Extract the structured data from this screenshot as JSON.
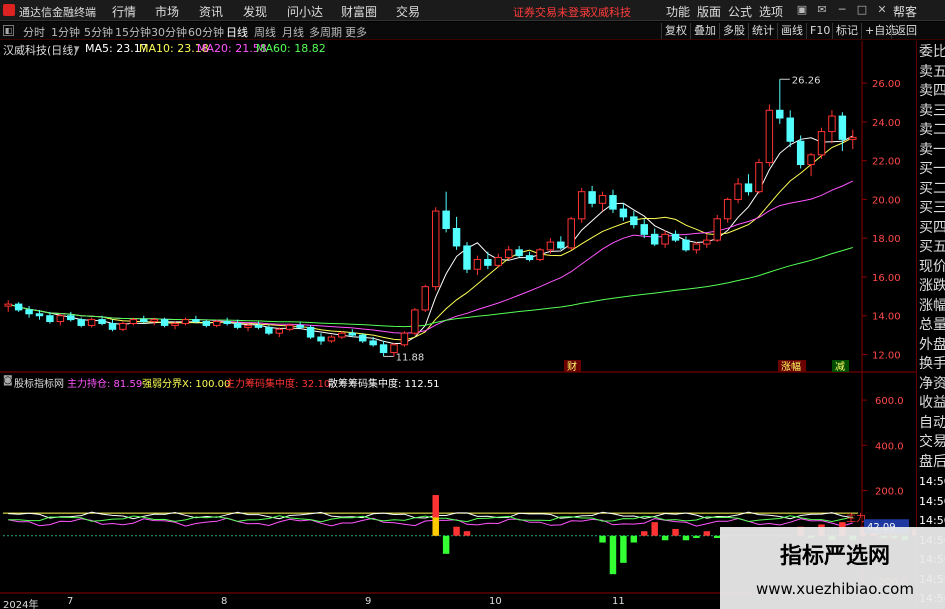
{
  "app": {
    "title": "通达信金融终端",
    "menu": [
      "行情",
      "市场",
      "资讯",
      "发现",
      "问小达",
      "财富圈",
      "交易"
    ],
    "login_status": "证券交易未登录",
    "stock_name": "汉威科技",
    "right_menu": [
      "功能",
      "版面",
      "公式",
      "选项"
    ],
    "helper": "帮客"
  },
  "toolbar": {
    "periods": [
      "分时",
      "1分钟",
      "5分钟",
      "15分钟",
      "30分钟",
      "60分钟",
      "日线",
      "周线",
      "月线",
      "多周期",
      "更多"
    ],
    "active_period": "日线",
    "right_buttons": [
      "复权",
      "叠加",
      "多股",
      "统计",
      "画线",
      "F10",
      "标记",
      "+自选",
      "返回"
    ]
  },
  "chart_header": {
    "symbol": "汉威科技(日线)",
    "ma": [
      {
        "label": "MA5: 23.17",
        "color": "#ffffff"
      },
      {
        "label": "MA10: 23.18",
        "color": "#ffff55"
      },
      {
        "label": "MA20: 21.58",
        "color": "#ff55ff"
      },
      {
        "label": "MA60: 18.82",
        "color": "#55ff55"
      }
    ]
  },
  "price_chart": {
    "type": "candlestick",
    "y_ticks": [
      "26.00",
      "24.00",
      "22.00",
      "20.00",
      "18.00",
      "16.00",
      "14.00",
      "12.00"
    ],
    "ylim": [
      11.2,
      27.4
    ],
    "high_label": "26.26",
    "low_label": "11.88",
    "event_tags": [
      "财",
      "涨幅",
      "减"
    ],
    "colors": {
      "up": "#ff3333",
      "down": "#54ffff"
    },
    "candles": [
      [
        14.5,
        14.8,
        14.2,
        14.6
      ],
      [
        14.6,
        14.7,
        14.2,
        14.3
      ],
      [
        14.3,
        14.5,
        13.9,
        14.1
      ],
      [
        14.1,
        14.3,
        13.8,
        14.0
      ],
      [
        14.0,
        14.2,
        13.6,
        13.7
      ],
      [
        13.7,
        14.1,
        13.5,
        14.0
      ],
      [
        14.0,
        14.2,
        13.7,
        13.8
      ],
      [
        13.8,
        13.9,
        13.4,
        13.5
      ],
      [
        13.5,
        13.9,
        13.4,
        13.8
      ],
      [
        13.8,
        14.0,
        13.5,
        13.6
      ],
      [
        13.6,
        13.8,
        13.2,
        13.3
      ],
      [
        13.3,
        13.7,
        13.2,
        13.6
      ],
      [
        13.6,
        13.9,
        13.5,
        13.8
      ],
      [
        13.8,
        14.0,
        13.6,
        13.7
      ],
      [
        13.7,
        13.9,
        13.5,
        13.8
      ],
      [
        13.8,
        13.9,
        13.4,
        13.5
      ],
      [
        13.5,
        13.7,
        13.3,
        13.6
      ],
      [
        13.6,
        13.9,
        13.5,
        13.8
      ],
      [
        13.8,
        14.0,
        13.6,
        13.7
      ],
      [
        13.7,
        13.8,
        13.4,
        13.5
      ],
      [
        13.5,
        13.8,
        13.4,
        13.7
      ],
      [
        13.7,
        13.9,
        13.5,
        13.6
      ],
      [
        13.6,
        13.8,
        13.3,
        13.4
      ],
      [
        13.4,
        13.6,
        13.2,
        13.5
      ],
      [
        13.5,
        13.7,
        13.3,
        13.4
      ],
      [
        13.4,
        13.5,
        13.0,
        13.1
      ],
      [
        13.1,
        13.4,
        12.9,
        13.3
      ],
      [
        13.3,
        13.6,
        13.2,
        13.5
      ],
      [
        13.5,
        13.7,
        13.3,
        13.4
      ],
      [
        13.4,
        13.5,
        12.8,
        12.9
      ],
      [
        12.9,
        13.1,
        12.5,
        12.7
      ],
      [
        12.7,
        13.0,
        12.6,
        12.9
      ],
      [
        12.9,
        13.2,
        12.8,
        13.1
      ],
      [
        13.1,
        13.3,
        12.9,
        13.0
      ],
      [
        13.0,
        13.1,
        12.6,
        12.7
      ],
      [
        12.7,
        12.9,
        12.4,
        12.5
      ],
      [
        12.5,
        12.7,
        11.9,
        12.1
      ],
      [
        12.1,
        12.6,
        11.9,
        12.5
      ],
      [
        12.5,
        13.2,
        12.4,
        13.1
      ],
      [
        13.1,
        14.4,
        13.0,
        14.3
      ],
      [
        14.3,
        15.6,
        14.2,
        15.5
      ],
      [
        15.5,
        19.6,
        15.3,
        19.4
      ],
      [
        19.4,
        20.4,
        18.3,
        18.5
      ],
      [
        18.5,
        19.1,
        17.4,
        17.6
      ],
      [
        17.6,
        17.8,
        16.2,
        16.4
      ],
      [
        16.4,
        17.1,
        16.1,
        16.9
      ],
      [
        16.9,
        17.3,
        16.4,
        16.6
      ],
      [
        16.6,
        17.2,
        16.5,
        17.0
      ],
      [
        17.0,
        17.6,
        16.9,
        17.4
      ],
      [
        17.4,
        17.6,
        17.0,
        17.1
      ],
      [
        17.1,
        17.3,
        16.8,
        16.9
      ],
      [
        16.9,
        17.5,
        16.8,
        17.4
      ],
      [
        17.4,
        18.0,
        17.2,
        17.8
      ],
      [
        17.8,
        18.1,
        17.4,
        17.5
      ],
      [
        17.5,
        19.1,
        17.4,
        19.0
      ],
      [
        19.0,
        20.6,
        18.8,
        20.4
      ],
      [
        20.4,
        20.7,
        19.6,
        19.8
      ],
      [
        19.8,
        20.4,
        19.4,
        20.2
      ],
      [
        20.2,
        20.5,
        19.3,
        19.5
      ],
      [
        19.5,
        19.8,
        18.9,
        19.1
      ],
      [
        19.1,
        19.4,
        18.5,
        18.7
      ],
      [
        18.7,
        19.0,
        18.0,
        18.2
      ],
      [
        18.2,
        18.5,
        17.6,
        17.7
      ],
      [
        17.7,
        18.4,
        17.5,
        18.2
      ],
      [
        18.2,
        18.4,
        17.8,
        17.9
      ],
      [
        17.9,
        18.1,
        17.3,
        17.4
      ],
      [
        17.4,
        17.8,
        17.2,
        17.7
      ],
      [
        17.7,
        18.2,
        17.5,
        17.9
      ],
      [
        17.9,
        19.2,
        17.8,
        19.0
      ],
      [
        19.0,
        20.1,
        18.8,
        20.0
      ],
      [
        20.0,
        21.1,
        19.8,
        20.8
      ],
      [
        20.8,
        21.3,
        20.2,
        20.4
      ],
      [
        20.4,
        22.1,
        20.3,
        21.9
      ],
      [
        21.9,
        24.9,
        21.7,
        24.6
      ],
      [
        24.6,
        26.2,
        23.9,
        24.2
      ],
      [
        24.2,
        24.6,
        22.7,
        23.0
      ],
      [
        23.0,
        23.3,
        21.6,
        21.8
      ],
      [
        21.8,
        22.4,
        21.2,
        22.3
      ],
      [
        22.3,
        23.7,
        22.1,
        23.5
      ],
      [
        23.5,
        24.6,
        22.9,
        24.3
      ],
      [
        24.3,
        24.5,
        22.5,
        23.1
      ],
      [
        23.1,
        23.6,
        22.6,
        23.2
      ]
    ]
  },
  "indicator": {
    "name": "股标指标网",
    "items": [
      {
        "label": "主力持仓: 81.59",
        "color": "#ff55ff"
      },
      {
        "label": "强弱分界X: 100.00",
        "color": "#ffff55"
      },
      {
        "label": "主力筹码集中度: 32.10",
        "color": "#ff3333"
      },
      {
        "label": "散筹筹码集中度: 112.51",
        "color": "#ffffff"
      }
    ],
    "y_ticks": [
      "600.0",
      "400.0",
      "200.0",
      "0.00",
      "-200.0"
    ],
    "ylim": [
      -240,
      680
    ],
    "tag": "主力",
    "current_value": "42.09",
    "bars": [
      [
        41,
        180
      ],
      [
        42,
        -80
      ],
      [
        43,
        40
      ],
      [
        44,
        20
      ],
      [
        57,
        -30
      ],
      [
        58,
        -170
      ],
      [
        59,
        -120
      ],
      [
        60,
        -30
      ],
      [
        61,
        20
      ],
      [
        62,
        60
      ],
      [
        63,
        -20
      ],
      [
        64,
        30
      ],
      [
        65,
        -20
      ],
      [
        66,
        -10
      ],
      [
        67,
        20
      ],
      [
        68,
        -10
      ],
      [
        76,
        40
      ],
      [
        77,
        -10
      ],
      [
        78,
        50
      ],
      [
        79,
        -20
      ],
      [
        80,
        60
      ],
      [
        81,
        -20
      ],
      [
        82,
        40
      ],
      [
        83,
        30
      ],
      [
        84,
        -10
      ],
      [
        85,
        -10
      ],
      [
        86,
        -20
      ],
      [
        87,
        30
      ],
      [
        88,
        20
      ],
      [
        89,
        40
      ],
      [
        90,
        -40
      ],
      [
        91,
        -10
      ],
      [
        93,
        -30
      ],
      [
        94,
        10
      ],
      [
        95,
        60
      ],
      [
        96,
        -20
      ],
      [
        97,
        30
      ],
      [
        98,
        560
      ],
      [
        99,
        -10
      ],
      [
        100,
        -120
      ],
      [
        101,
        30
      ],
      [
        102,
        70
      ],
      [
        103,
        -120
      ],
      [
        104,
        40
      ],
      [
        105,
        110
      ],
      [
        106,
        -30
      ],
      [
        107,
        -10
      ],
      [
        108,
        -120
      ],
      [
        109,
        60
      ],
      [
        110,
        -10
      ]
    ]
  },
  "right_panel": {
    "items": [
      "委比",
      "卖五",
      "卖四",
      "卖三",
      "卖二",
      "卖一",
      "买一",
      "买二",
      "买三",
      "买四",
      "买五",
      "现价",
      "涨跌",
      "涨幅",
      "总量",
      "外盘",
      "换手",
      "净资",
      "收益",
      "自动",
      "交易",
      "盘后",
      "14:50",
      "14:50",
      "14:50",
      "14:50",
      "14:50",
      "14:50",
      "14:50"
    ]
  },
  "date_axis": [
    "2024年",
    "7",
    "8",
    "9",
    "10",
    "11"
  ],
  "watermark": {
    "title": "指标严选网",
    "url": "www.xuezhibiao.com"
  }
}
